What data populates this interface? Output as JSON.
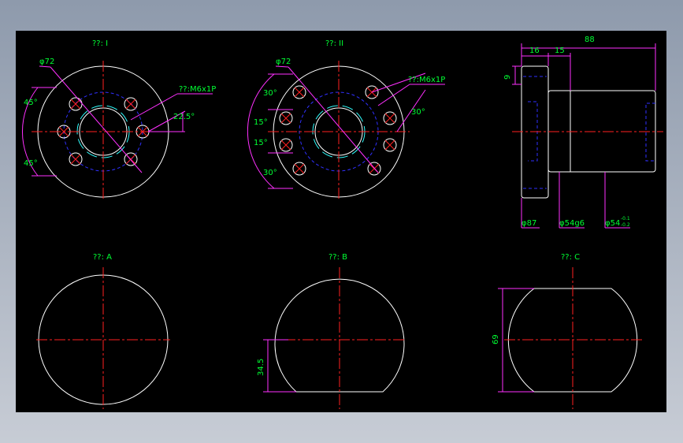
{
  "views": {
    "view1_title": "??: I",
    "view2_title": "??: II",
    "viewA_title": "??: A",
    "viewB_title": "??: B",
    "viewC_title": "??: C"
  },
  "dimensions": {
    "phi72": "φ72",
    "thread": "??:M6x1P",
    "angle_45": "45°",
    "angle_22_5": "22.5°",
    "angle_30": "30°",
    "angle_15": "15°",
    "len_88": "88",
    "len_16": "16",
    "len_15": "15",
    "len_9": "9",
    "phi87": "φ87",
    "phi54g6": "φ54g6",
    "phi54_tol": "φ54",
    "tol_upper": "-0.1",
    "tol_lower": "-0.2",
    "dim_34_5": "34.5",
    "dim_69": "69"
  },
  "colors": {
    "background": "#000000",
    "outline": "#ffffff",
    "centerline": "#ff2020",
    "hidden": "#3030ff",
    "dimension": "#ff30ff",
    "text": "#00ff33",
    "thread": "#30ffff"
  }
}
